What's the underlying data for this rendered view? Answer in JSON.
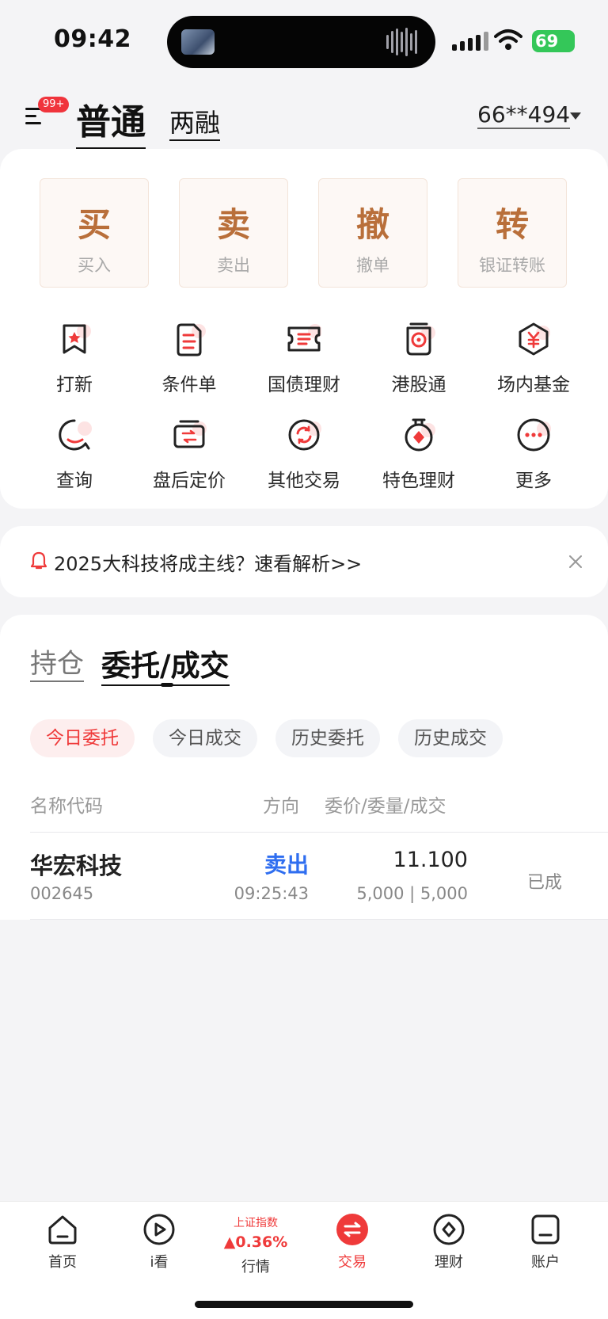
{
  "status_bar": {
    "time": "09:42",
    "battery": "69"
  },
  "header": {
    "badge": "99+",
    "tab_normal": "普通",
    "tab_margin": "两融",
    "account": "66**494"
  },
  "actions": [
    {
      "glyph": "买",
      "label": "买入"
    },
    {
      "glyph": "卖",
      "label": "卖出"
    },
    {
      "glyph": "撤",
      "label": "撤单"
    },
    {
      "glyph": "转",
      "label": "银证转账"
    }
  ],
  "grid": [
    {
      "label": "打新",
      "icon": "ipo-bookmark-icon"
    },
    {
      "label": "条件单",
      "icon": "conditional-order-icon"
    },
    {
      "label": "国债理财",
      "icon": "treasury-ticket-icon"
    },
    {
      "label": "港股通",
      "icon": "hk-connect-icon"
    },
    {
      "label": "场内基金",
      "icon": "fund-yen-icon"
    },
    {
      "label": "查询",
      "icon": "query-icon"
    },
    {
      "label": "盘后定价",
      "icon": "after-hours-icon"
    },
    {
      "label": "其他交易",
      "icon": "other-trade-icon"
    },
    {
      "label": "特色理财",
      "icon": "featured-finance-icon"
    },
    {
      "label": "更多",
      "icon": "more-icon"
    }
  ],
  "notice": {
    "text": "2025大科技将成主线？速看解析>>"
  },
  "orders": {
    "tab_holdings": "持仓",
    "tab_orders": "委托/成交",
    "filters": [
      "今日委托",
      "今日成交",
      "历史委托",
      "历史成交"
    ],
    "columns": {
      "name": "名称代码",
      "direction": "方向",
      "price": "委价/委量/成交"
    },
    "rows": [
      {
        "name": "华宏科技",
        "code": "002645",
        "direction": "卖出",
        "time": "09:25:43",
        "price": "11.100",
        "qty": "5,000 | 5,000",
        "status": "已成"
      }
    ]
  },
  "bottom_nav": {
    "home": "首页",
    "watch": "i看",
    "index_name": "上证指数",
    "index_value": "▲0.36%",
    "market": "行情",
    "trade": "交易",
    "finance": "理财",
    "account": "账户"
  },
  "colors": {
    "accent": "#ef3a3a",
    "action_glyph": "#b96f3a",
    "sell_blue": "#2f6ef0"
  }
}
